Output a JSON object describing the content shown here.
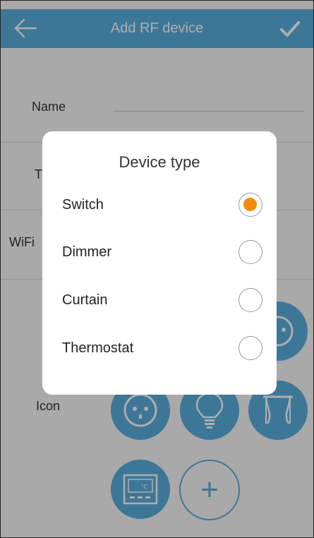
{
  "header": {
    "title": "Add RF device",
    "back_icon": "arrow-left-icon",
    "confirm_icon": "check-icon"
  },
  "form": {
    "name_label": "Name",
    "type_label": "T",
    "wifi_label": "WiFi",
    "icon_label": "Icon"
  },
  "icons": [
    "socket-icon",
    "bulb-icon",
    "curtain-icon",
    "thermostat-icon",
    "add-icon"
  ],
  "thermostat_display": "°C",
  "add_symbol": "+",
  "dialog": {
    "title": "Device type",
    "options": [
      {
        "label": "Switch",
        "selected": true
      },
      {
        "label": "Dimmer",
        "selected": false
      },
      {
        "label": "Curtain",
        "selected": false
      },
      {
        "label": "Thermostat",
        "selected": false
      }
    ]
  },
  "colors": {
    "accent": "#5ab0e0",
    "selected_radio": "#f28a0e"
  }
}
